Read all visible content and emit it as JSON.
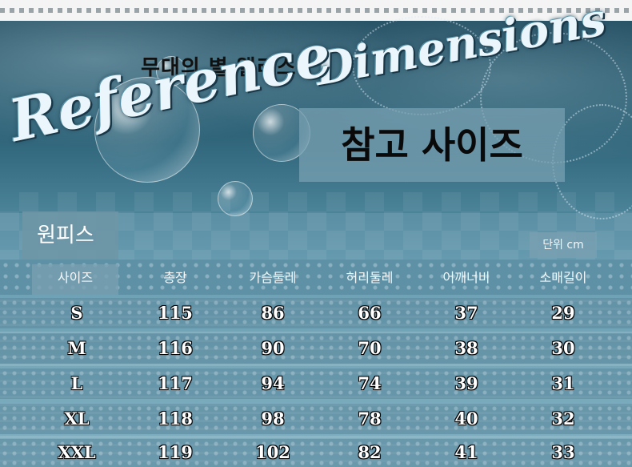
{
  "header": {
    "subtitle": "무대의 별 앨리스",
    "script_reference": "Reference",
    "script_dimensions": "Dimensions",
    "title": "참고 사이즈"
  },
  "category": "원피스",
  "unit": "단위 cm",
  "table": {
    "columns": [
      "사이즈",
      "총장",
      "가슴둘레",
      "허리둘레",
      "어깨너비",
      "소매길이"
    ],
    "rows": [
      [
        "S",
        "115",
        "86",
        "66",
        "37",
        "29"
      ],
      [
        "M",
        "116",
        "90",
        "70",
        "38",
        "30"
      ],
      [
        "L",
        "117",
        "94",
        "74",
        "39",
        "31"
      ],
      [
        "XL",
        "118",
        "98",
        "78",
        "40",
        "32"
      ],
      [
        "XXL",
        "119",
        "102",
        "82",
        "41",
        "33"
      ]
    ]
  }
}
